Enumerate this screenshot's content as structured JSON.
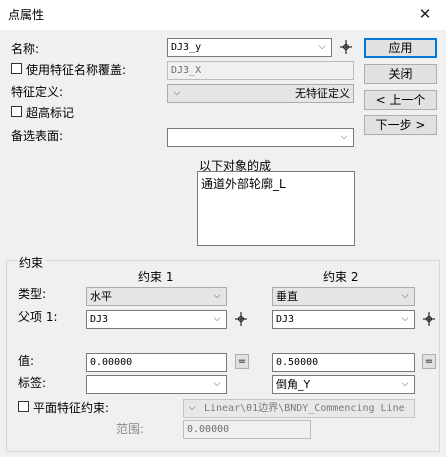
{
  "title": "点属性",
  "close_symbol": "✕",
  "name": {
    "label": "名称:",
    "value": "DJ3_y"
  },
  "override": {
    "label": "使用特征名称覆盖:",
    "value": "DJ3_X"
  },
  "feature_def": {
    "label": "特征定义:",
    "value": "无特征定义"
  },
  "elevation_mark": {
    "label": "超高标记"
  },
  "alt_surface": {
    "label": "备选表面:",
    "value": ""
  },
  "composed_of": {
    "label": "以下对象的成",
    "items": [
      "通道外部轮廓_L"
    ]
  },
  "buttons": {
    "apply": "应用",
    "close": "关闭",
    "prev": "< 上一个",
    "next": "下一步 >"
  },
  "constraints": {
    "group_label": "约束",
    "type_label": "类型:",
    "parent_label": "父项 1:",
    "value_label": "值:",
    "tag_label": "标签:",
    "c1": {
      "header": "约束 1",
      "type": "水平",
      "parent": "DJ3",
      "value": "0.00000",
      "tag": ""
    },
    "c2": {
      "header": "约束 2",
      "type": "垂直",
      "parent": "DJ3",
      "value": "0.50000",
      "tag": "倒角_Y"
    },
    "eq_symbol": "="
  },
  "plane_constraint": {
    "label": "平面特征约束:",
    "value": "Linear\\01边界\\BNDY_Commencing Line"
  },
  "range": {
    "label": "范围:",
    "value": "0.00000"
  },
  "icons": {
    "pick": "crosshair-pick-icon",
    "dropdown": "chevron-down-icon"
  },
  "dropdown_symbol": "⌵"
}
